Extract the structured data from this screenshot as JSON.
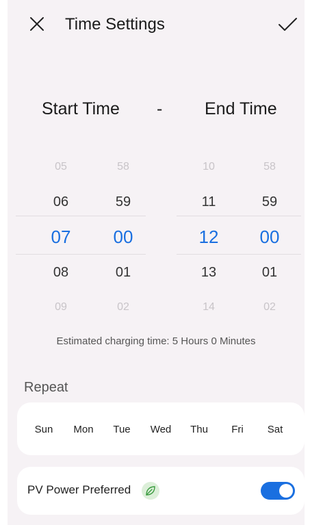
{
  "header": {
    "title": "Time Settings",
    "close_icon": "close-icon",
    "confirm_icon": "check-icon"
  },
  "range": {
    "start_label": "Start Time",
    "separator": "-",
    "end_label": "End Time"
  },
  "start_picker": {
    "hours": [
      "05",
      "06",
      "07",
      "08",
      "09"
    ],
    "minutes": [
      "58",
      "59",
      "00",
      "01",
      "02"
    ]
  },
  "end_picker": {
    "hours": [
      "10",
      "11",
      "12",
      "13",
      "14"
    ],
    "minutes": [
      "58",
      "59",
      "00",
      "01",
      "02"
    ]
  },
  "estimate": "Estimated charging time: 5 Hours 0 Minutes",
  "repeat": {
    "label": "Repeat",
    "days": [
      "Sun",
      "Mon",
      "Tue",
      "Wed",
      "Thu",
      "Fri",
      "Sat"
    ]
  },
  "pv": {
    "label": "PV Power Preferred",
    "icon": "leaf-icon",
    "enabled": true
  },
  "colors": {
    "accent": "#1a6fe0",
    "background": "#f6f2f5",
    "leaf_bg": "#dcefd9"
  }
}
